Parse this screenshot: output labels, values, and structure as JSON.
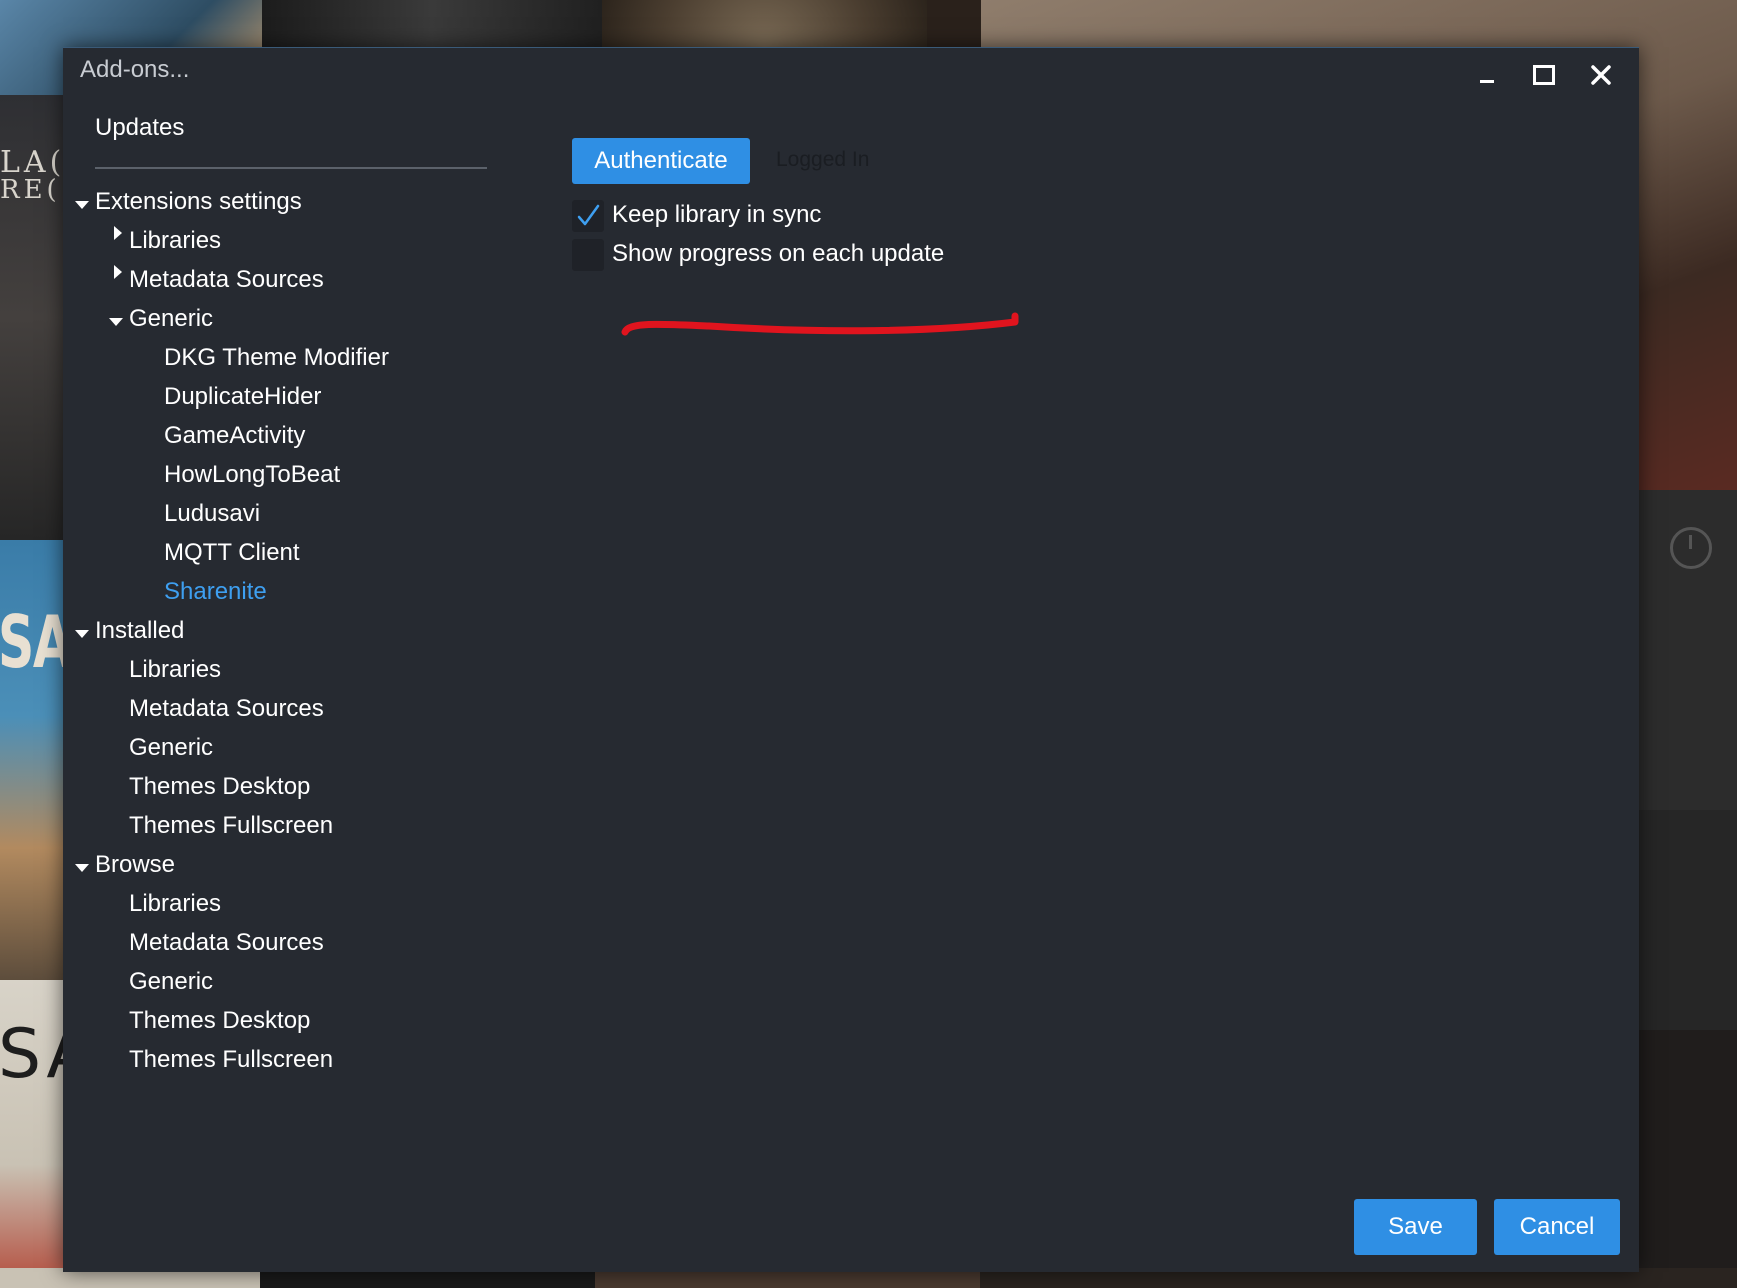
{
  "window": {
    "title": "Add-ons..."
  },
  "sidebar": {
    "header": "Updates",
    "sections": [
      {
        "label": "Extensions settings",
        "expanded": true
      },
      {
        "label": "Libraries",
        "expanded": false
      },
      {
        "label": "Metadata Sources",
        "expanded": false
      },
      {
        "label": "Generic",
        "expanded": true
      },
      {
        "label": "DKG Theme Modifier"
      },
      {
        "label": "DuplicateHider"
      },
      {
        "label": "GameActivity"
      },
      {
        "label": "HowLongToBeat"
      },
      {
        "label": "Ludusavi"
      },
      {
        "label": "MQTT Client"
      },
      {
        "label": "Sharenite",
        "selected": true
      },
      {
        "label": "Installed",
        "expanded": true
      },
      {
        "label": "Libraries"
      },
      {
        "label": "Metadata Sources"
      },
      {
        "label": "Generic"
      },
      {
        "label": "Themes Desktop"
      },
      {
        "label": "Themes Fullscreen"
      },
      {
        "label": "Browse",
        "expanded": true
      },
      {
        "label": "Libraries"
      },
      {
        "label": "Metadata Sources"
      },
      {
        "label": "Generic"
      },
      {
        "label": "Themes Desktop"
      },
      {
        "label": "Themes Fullscreen"
      }
    ]
  },
  "settings": {
    "authenticate_label": "Authenticate",
    "status_text": "Logged In",
    "options": [
      {
        "label": "Keep library in sync",
        "checked": true
      },
      {
        "label": "Show progress on each update",
        "checked": false
      }
    ]
  },
  "footer": {
    "save_label": "Save",
    "cancel_label": "Cancel"
  },
  "colors": {
    "accent": "#2f8fe4",
    "selected_text": "#3e9ff0",
    "dialog_bg": "#262a31",
    "annotation": "#e0141e"
  },
  "icons": {
    "minimize": "minimize-icon",
    "maximize": "maximize-icon",
    "close": "close-icon",
    "expand": "chevron-down-icon",
    "collapse": "chevron-right-icon",
    "check": "checkmark-icon"
  }
}
